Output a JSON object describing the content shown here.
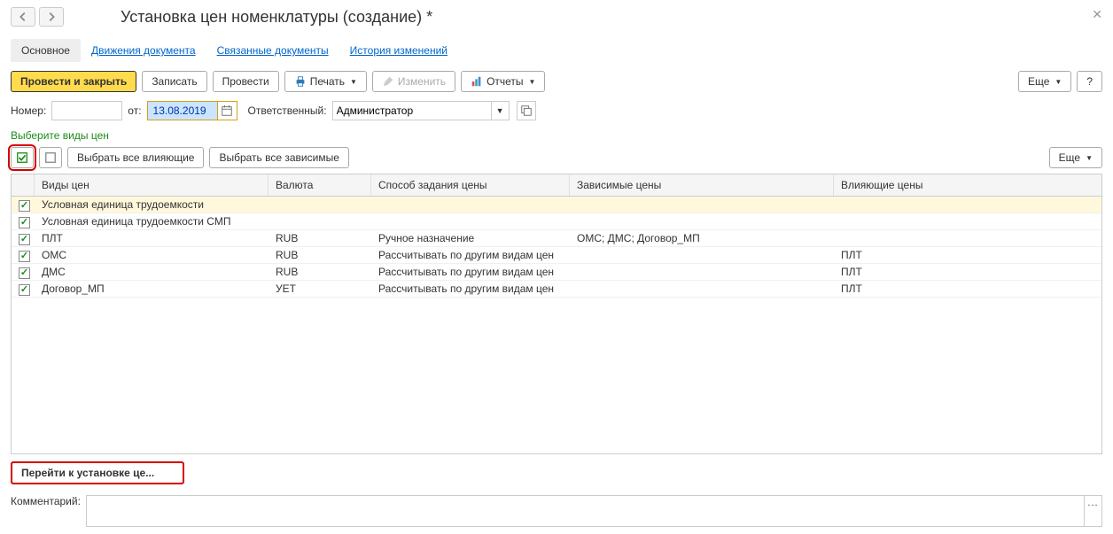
{
  "header": {
    "title": "Установка цен номенклатуры (создание) *"
  },
  "tabs": {
    "main": "Основное",
    "movements": "Движения документа",
    "related": "Связанные документы",
    "history": "История изменений"
  },
  "toolbar": {
    "post_close": "Провести и закрыть",
    "save": "Записать",
    "post": "Провести",
    "print": "Печать",
    "change": "Изменить",
    "reports": "Отчеты",
    "more": "Еще",
    "help": "?"
  },
  "form": {
    "number_label": "Номер:",
    "number_value": "",
    "from_label": "от:",
    "date_value": "13.08.2019",
    "responsible_label": "Ответственный:",
    "responsible_value": "Администратор"
  },
  "section": {
    "title": "Выберите виды цен"
  },
  "subtoolbar": {
    "select_influencing": "Выбрать все влияющие",
    "select_dependent": "Выбрать все зависимые",
    "more": "Еще"
  },
  "table": {
    "headers": {
      "name": "Виды цен",
      "currency": "Валюта",
      "method": "Способ задания цены",
      "dependent": "Зависимые цены",
      "influencing": "Влияющие цены"
    },
    "rows": [
      {
        "checked": true,
        "hl": true,
        "name": "Условная единица трудоемкости",
        "currency": "",
        "method": "",
        "dependent": "",
        "influencing": ""
      },
      {
        "checked": true,
        "hl": false,
        "name": "Условная единица трудоемкости СМП",
        "currency": "",
        "method": "",
        "dependent": "",
        "influencing": ""
      },
      {
        "checked": true,
        "hl": false,
        "name": "ПЛТ",
        "currency": "RUB",
        "method": "Ручное назначение",
        "dependent": "ОМС; ДМС; Договор_МП",
        "influencing": ""
      },
      {
        "checked": true,
        "hl": false,
        "name": "ОМС",
        "currency": "RUB",
        "method": "Рассчитывать по другим видам цен",
        "dependent": "",
        "influencing": "ПЛТ"
      },
      {
        "checked": true,
        "hl": false,
        "name": "ДМС",
        "currency": "RUB",
        "method": "Рассчитывать по другим видам цен",
        "dependent": "",
        "influencing": "ПЛТ"
      },
      {
        "checked": true,
        "hl": false,
        "name": "Договор_МП",
        "currency": "УЕТ",
        "method": "Рассчитывать по другим видам цен",
        "dependent": "",
        "influencing": "ПЛТ"
      }
    ]
  },
  "footer": {
    "goto_prices": "Перейти к установке це...",
    "comment_label": "Комментарий:",
    "comment_value": ""
  }
}
